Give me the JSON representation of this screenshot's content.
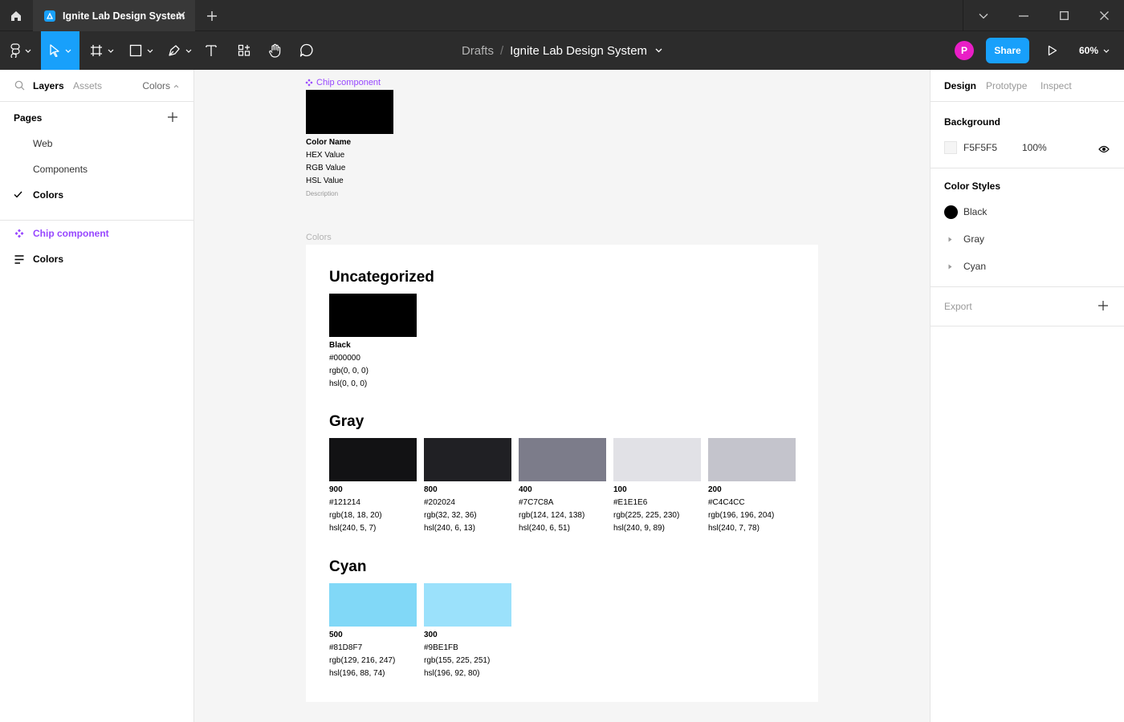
{
  "titlebar": {
    "tab_title": "Ignite Lab Design System"
  },
  "toolbar": {
    "breadcrumb_root": "Drafts",
    "breadcrumb_sep": "/",
    "file_name": "Ignite Lab Design System",
    "avatar_initial": "P",
    "share_label": "Share",
    "zoom_label": "60%",
    "accent_color": "#18a0fb"
  },
  "left_panel": {
    "tabs": [
      "Layers",
      "Assets"
    ],
    "page_selector": "Colors",
    "pages_heading": "Pages",
    "pages": [
      "Web",
      "Components",
      "Colors"
    ],
    "selected_page": "Colors",
    "layers": [
      {
        "label": "Chip component",
        "kind": "component",
        "color": "#9747ff"
      },
      {
        "label": "Colors",
        "kind": "frame",
        "color": "#000000"
      }
    ]
  },
  "canvas": {
    "background": "#F5F5F5",
    "chip": {
      "label": "Chip component",
      "color_name": "Color Name",
      "hex": "HEX Value",
      "rgb": "RGB Value",
      "hsl": "HSL Value",
      "description": "Description"
    },
    "frame_label": "Colors",
    "sections": [
      {
        "title": "Uncategorized",
        "swatches": [
          {
            "name": "Black",
            "color": "#000000",
            "hex": "#000000",
            "rgb": "rgb(0, 0, 0)",
            "hsl": "hsl(0, 0, 0)"
          }
        ]
      },
      {
        "title": "Gray",
        "swatches": [
          {
            "name": "900",
            "color": "#121214",
            "hex": "#121214",
            "rgb": "rgb(18, 18, 20)",
            "hsl": "hsl(240, 5, 7)"
          },
          {
            "name": "800",
            "color": "#202024",
            "hex": "#202024",
            "rgb": "rgb(32, 32, 36)",
            "hsl": "hsl(240, 6, 13)"
          },
          {
            "name": "400",
            "color": "#7C7C8A",
            "hex": "#7C7C8A",
            "rgb": "rgb(124, 124, 138)",
            "hsl": "hsl(240, 6, 51)"
          },
          {
            "name": "100",
            "color": "#E1E1E6",
            "hex": "#E1E1E6",
            "rgb": "rgb(225, 225, 230)",
            "hsl": "hsl(240, 9, 89)"
          },
          {
            "name": "200",
            "color": "#C4C4CC",
            "hex": "#C4C4CC",
            "rgb": "rgb(196, 196, 204)",
            "hsl": "hsl(240, 7, 78)"
          }
        ]
      },
      {
        "title": "Cyan",
        "swatches": [
          {
            "name": "500",
            "color": "#81D8F7",
            "hex": "#81D8F7",
            "rgb": "rgb(129, 216, 247)",
            "hsl": "hsl(196, 88, 74)"
          },
          {
            "name": "300",
            "color": "#9BE1FB",
            "hex": "#9BE1FB",
            "rgb": "rgb(155, 225, 251)",
            "hsl": "hsl(196, 92, 80)"
          }
        ]
      }
    ],
    "help_label": "?"
  },
  "right_panel": {
    "tabs": [
      "Design",
      "Prototype",
      "Inspect"
    ],
    "active_tab": "Design",
    "background_heading": "Background",
    "background_hex": "F5F5F5",
    "background_opacity": "100%",
    "color_styles_heading": "Color Styles",
    "color_styles": [
      "Black",
      "Gray",
      "Cyan"
    ],
    "export_heading": "Export"
  }
}
